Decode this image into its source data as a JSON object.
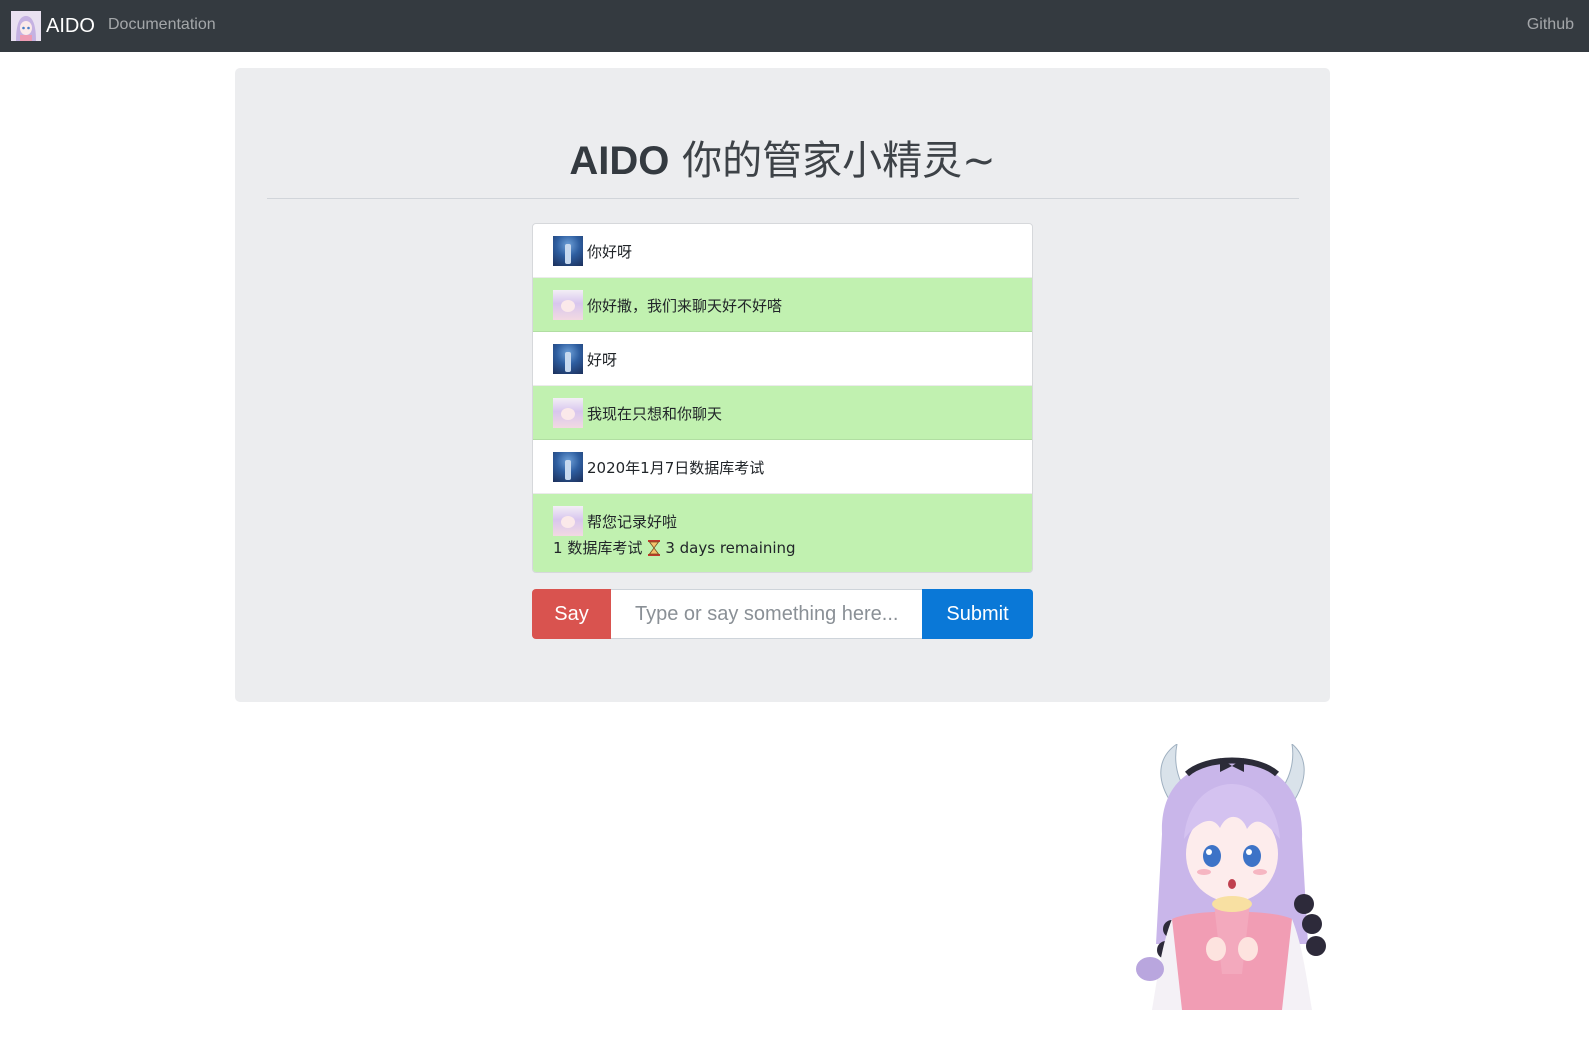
{
  "navbar": {
    "brand": "AIDO",
    "doc_link": "Documentation",
    "github_link": "Github"
  },
  "header": {
    "name": "AIDO",
    "slogan": " 你的管家小精灵~"
  },
  "messages": [
    {
      "sender": "user",
      "text": "你好呀"
    },
    {
      "sender": "bot",
      "text": "你好撒，我们来聊天好不好嗒"
    },
    {
      "sender": "user",
      "text": "好呀"
    },
    {
      "sender": "bot",
      "text": "我现在只想和你聊天"
    },
    {
      "sender": "user",
      "text": "2020年1月7日数据库考试"
    },
    {
      "sender": "bot",
      "text": "帮您记录好啦",
      "todo_index": "1",
      "todo_name": "数据库考试",
      "todo_remaining": "3 days remaining"
    }
  ],
  "input": {
    "say_label": "Say",
    "placeholder": "Type or say something here...",
    "value": "",
    "submit_label": "Submit"
  },
  "colors": {
    "navbar_bg": "#343a40",
    "jumbotron_bg": "#ecedef",
    "bot_message_bg": "#c1f1b0",
    "say_button": "#d9534f",
    "submit_button": "#0a78d7"
  },
  "icons": {
    "hourglass": "hourglass-icon",
    "user_avatar": "user-avatar",
    "bot_avatar": "bot-avatar",
    "mascot": "mascot-image"
  }
}
